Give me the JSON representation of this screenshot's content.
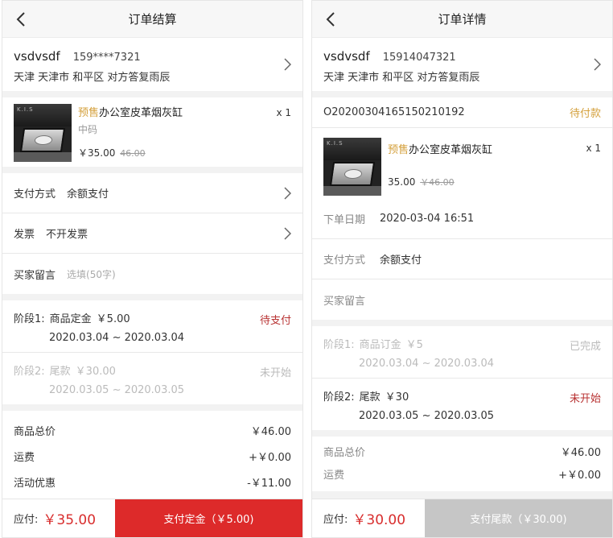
{
  "checkout": {
    "nav_title": "订单结算",
    "address": {
      "name": "vsdvsdf",
      "phone": "159****7321",
      "full": "天津 天津市 和平区 对方答复雨辰"
    },
    "product": {
      "presale_tag": "预售",
      "name": "办公室皮革烟灰缸",
      "spec": "中码",
      "price": "￥35.00",
      "orig_price": "46.00",
      "qty": "x 1",
      "thumb_brand": "K.I.S"
    },
    "payment_label": "支付方式",
    "payment_value": "余额支付",
    "invoice_label": "发票",
    "invoice_value": "不开发票",
    "note_label": "买家留言",
    "note_placeholder": "选填(50字)",
    "stage1": {
      "title": "阶段1:",
      "name": "商品定金",
      "amount": "￥5.00",
      "dates": "2020.03.04 ~ 2020.03.04",
      "status": "待支付"
    },
    "stage2": {
      "title": "阶段2:",
      "name": "尾款",
      "amount": "￥30.00",
      "dates": "2020.03.05 ~ 2020.03.05",
      "status": "未开始"
    },
    "summary": [
      {
        "label": "商品总价",
        "value": "￥46.00"
      },
      {
        "label": "运费",
        "value": "+￥0.00"
      },
      {
        "label": "活动优惠",
        "value": "-￥11.00"
      }
    ],
    "due_label": "应付:",
    "due_amount": "￥35.00",
    "pay_button": "支付定金（￥5.00)"
  },
  "detail": {
    "nav_title": "订单详情",
    "address": {
      "name": "vsdvsdf",
      "phone": "15914047321",
      "full": "天津 天津市 和平区 对方答复雨辰"
    },
    "order_no": "O20200304165150210192",
    "order_status": "待付款",
    "product": {
      "presale_tag": "预售",
      "name": "办公室皮革烟灰缸",
      "price": "35.00",
      "orig_price": "￥46.00",
      "qty": "x 1",
      "thumb_brand": "K.I.S"
    },
    "order_date_label": "下单日期",
    "order_date": "2020-03-04 16:51",
    "payment_label": "支付方式",
    "payment_value": "余额支付",
    "note_label": "买家留言",
    "stage1": {
      "title": "阶段1:",
      "name": "商品订金",
      "amount": "￥5",
      "dates": "2020.03.04 ~ 2020.03.04",
      "status": "已完成"
    },
    "stage2": {
      "title": "阶段2:",
      "name": "尾款",
      "amount": "￥30",
      "dates": "2020.03.05 ~ 2020.03.05",
      "status": "未开始"
    },
    "summary": [
      {
        "label": "商品总价",
        "value": "￥46.00"
      },
      {
        "label": "运费",
        "value": "+￥0.00"
      }
    ],
    "due_label": "应付:",
    "due_amount": "￥30.00",
    "pay_button": "支付尾款（￥30.00)"
  },
  "colors": {
    "accent_red": "#dd2a2a",
    "presale_gold": "#d4a03c",
    "disabled_grey": "#c6c6c6"
  },
  "icons": [
    "back-arrow-icon",
    "chevron-right-icon"
  ]
}
